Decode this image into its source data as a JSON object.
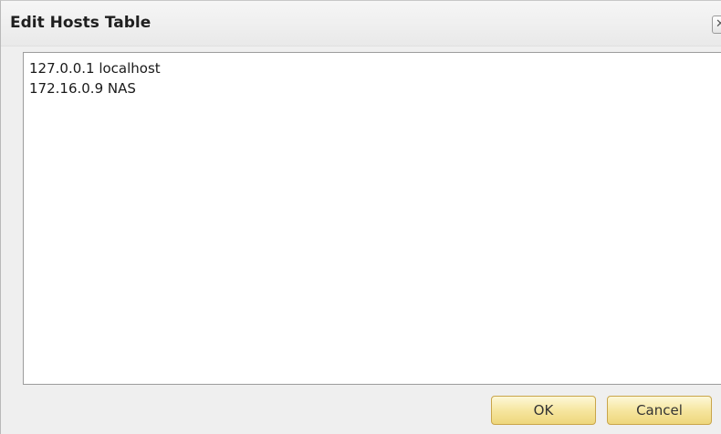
{
  "dialog": {
    "title": "Edit Hosts Table",
    "close_icon": "close-icon",
    "close_glyph": "✕",
    "hosts_text": "127.0.0.1 localhost\n172.16.0.9 NAS",
    "ok_label": "OK",
    "cancel_label": "Cancel"
  },
  "colors": {
    "button_fill": "#f6e6a0",
    "button_border": "#c9a54a",
    "dialog_background": "#efefef",
    "text_area_background": "#ffffff"
  }
}
